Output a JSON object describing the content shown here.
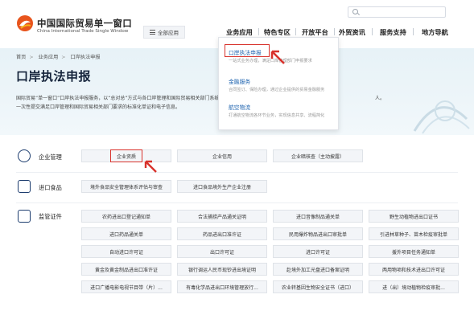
{
  "header": {
    "logo_cn": "中国国际贸易单一窗口",
    "logo_en": "China International Trade Single Window",
    "all_apps": "全部应用",
    "nav": [
      "业务应用",
      "特色专区",
      "开放平台",
      "外贸资讯",
      "服务支持",
      "地方导航"
    ]
  },
  "breadcrumb": [
    "首页",
    "业务应用",
    "口岸执法申报"
  ],
  "page_title": "口岸执法申报",
  "description": [
    "国际贸易“单一窗口”口岸执法申报服务，以“总对总”方式与各口岸管理和国际贸易相关部门系统对接，实现申报人通过“单一窗口”",
    "一次性提交满足口岸管理和国际贸易相关部门要求的标准化单证和电子信息。"
  ],
  "description_tail": "人。",
  "dropdown": [
    {
      "title": "口岸执法申报",
      "subtitle": "一站式业务办理，满足口岸管理部门申报要求"
    },
    {
      "title": "金融服务",
      "subtitle": "合同签订、保险办理，通过企业提供的贸易金融服务"
    },
    {
      "title": "航空物流",
      "subtitle": "打通航空物流各环节业务，实现信息共享、流程简化"
    }
  ],
  "sections": [
    {
      "name": "企业管理",
      "buttons": [
        "企业资质",
        "企业信用",
        "企业暗核查（主动披露）"
      ]
    },
    {
      "name": "进口食品",
      "buttons": [
        "境外食品安全管理体系评估与审查",
        "进口食品境外生产企业注册"
      ]
    },
    {
      "name": "监管证件",
      "buttons": [
        "农药进出口登记通知单",
        "合法捕捞产品通关证明",
        "进口音像制品通关单",
        "野生动植物进出口证书",
        "进口药品通关单",
        "药品进出口准许证",
        "民用爆炸物品进出口审批单",
        "引进林草种子、苗木检疫审批单",
        "自动进口许可证",
        "出口许可证",
        "进口许可证",
        "援外项目任务通知单",
        "黄金及黄金制品进出口准许证",
        "银行调运人民币现钞进出境证明",
        "赴境外加工光盘进口备案证明",
        "两用物项和技术进出口许可证",
        "进口广播电影电视节目带（片）...",
        "有毒化学品进出口环境管理放行...",
        "农业转基因生物安全证书（进口）",
        "进（出）境动植物检疫审批..."
      ]
    }
  ],
  "accent_color": "#d8322c",
  "primary_color": "#1c3c6e",
  "icons": [
    "search-icon",
    "hamburger-icon",
    "logo-emblem-icon",
    "building-icon",
    "food-icon",
    "certificate-icon",
    "red-arrow-icon"
  ]
}
